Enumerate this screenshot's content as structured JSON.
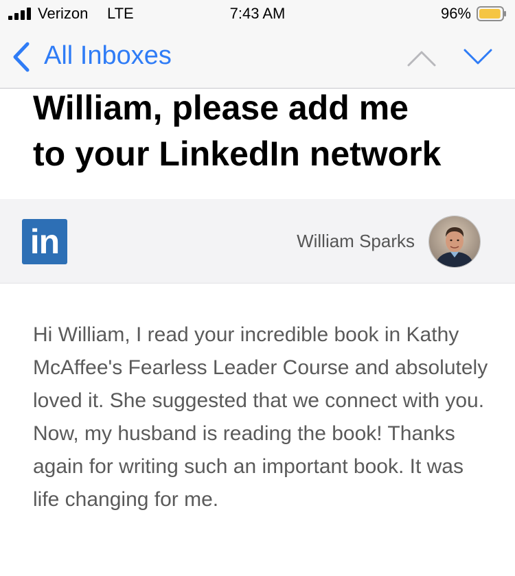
{
  "status_bar": {
    "carrier": "Verizon",
    "network": "LTE",
    "time": "7:43 AM",
    "battery_percent": "96%",
    "battery_level": 0.96,
    "battery_color": "#f5c542"
  },
  "nav": {
    "back_label": "All Inboxes",
    "back_icon": "chevron-left-icon",
    "prev_icon": "chevron-up-icon",
    "next_icon": "chevron-down-icon",
    "accent_color": "#2f7cf6"
  },
  "email": {
    "subject_line1": "William, please add me",
    "subject_line2": "to your LinkedIn network",
    "logo_text": "in",
    "logo_color": "#2d6fb5",
    "sender_name": "William Sparks",
    "body": "Hi William, I read your incredible book in Kathy McAffee's Fearless Leader Course and absolutely loved it. She suggested that we connect with you. Now, my husband is reading the book! Thanks again for writing such an important book. It was life changing for me."
  }
}
